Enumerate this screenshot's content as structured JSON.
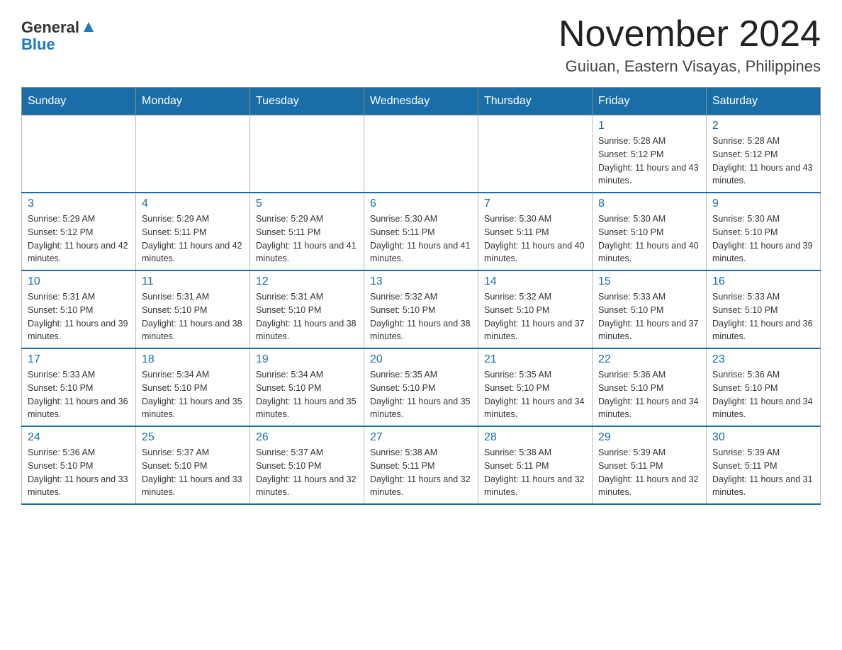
{
  "header": {
    "logo_general": "General",
    "logo_blue": "Blue",
    "main_title": "November 2024",
    "subtitle": "Guiuan, Eastern Visayas, Philippines"
  },
  "calendar": {
    "headers": [
      "Sunday",
      "Monday",
      "Tuesday",
      "Wednesday",
      "Thursday",
      "Friday",
      "Saturday"
    ],
    "weeks": [
      {
        "days": [
          {
            "number": "",
            "info": "",
            "empty": true
          },
          {
            "number": "",
            "info": "",
            "empty": true
          },
          {
            "number": "",
            "info": "",
            "empty": true
          },
          {
            "number": "",
            "info": "",
            "empty": true
          },
          {
            "number": "",
            "info": "",
            "empty": true
          },
          {
            "number": "1",
            "info": "Sunrise: 5:28 AM\nSunset: 5:12 PM\nDaylight: 11 hours and 43 minutes.",
            "empty": false
          },
          {
            "number": "2",
            "info": "Sunrise: 5:28 AM\nSunset: 5:12 PM\nDaylight: 11 hours and 43 minutes.",
            "empty": false
          }
        ]
      },
      {
        "days": [
          {
            "number": "3",
            "info": "Sunrise: 5:29 AM\nSunset: 5:12 PM\nDaylight: 11 hours and 42 minutes.",
            "empty": false
          },
          {
            "number": "4",
            "info": "Sunrise: 5:29 AM\nSunset: 5:11 PM\nDaylight: 11 hours and 42 minutes.",
            "empty": false
          },
          {
            "number": "5",
            "info": "Sunrise: 5:29 AM\nSunset: 5:11 PM\nDaylight: 11 hours and 41 minutes.",
            "empty": false
          },
          {
            "number": "6",
            "info": "Sunrise: 5:30 AM\nSunset: 5:11 PM\nDaylight: 11 hours and 41 minutes.",
            "empty": false
          },
          {
            "number": "7",
            "info": "Sunrise: 5:30 AM\nSunset: 5:11 PM\nDaylight: 11 hours and 40 minutes.",
            "empty": false
          },
          {
            "number": "8",
            "info": "Sunrise: 5:30 AM\nSunset: 5:10 PM\nDaylight: 11 hours and 40 minutes.",
            "empty": false
          },
          {
            "number": "9",
            "info": "Sunrise: 5:30 AM\nSunset: 5:10 PM\nDaylight: 11 hours and 39 minutes.",
            "empty": false
          }
        ]
      },
      {
        "days": [
          {
            "number": "10",
            "info": "Sunrise: 5:31 AM\nSunset: 5:10 PM\nDaylight: 11 hours and 39 minutes.",
            "empty": false
          },
          {
            "number": "11",
            "info": "Sunrise: 5:31 AM\nSunset: 5:10 PM\nDaylight: 11 hours and 38 minutes.",
            "empty": false
          },
          {
            "number": "12",
            "info": "Sunrise: 5:31 AM\nSunset: 5:10 PM\nDaylight: 11 hours and 38 minutes.",
            "empty": false
          },
          {
            "number": "13",
            "info": "Sunrise: 5:32 AM\nSunset: 5:10 PM\nDaylight: 11 hours and 38 minutes.",
            "empty": false
          },
          {
            "number": "14",
            "info": "Sunrise: 5:32 AM\nSunset: 5:10 PM\nDaylight: 11 hours and 37 minutes.",
            "empty": false
          },
          {
            "number": "15",
            "info": "Sunrise: 5:33 AM\nSunset: 5:10 PM\nDaylight: 11 hours and 37 minutes.",
            "empty": false
          },
          {
            "number": "16",
            "info": "Sunrise: 5:33 AM\nSunset: 5:10 PM\nDaylight: 11 hours and 36 minutes.",
            "empty": false
          }
        ]
      },
      {
        "days": [
          {
            "number": "17",
            "info": "Sunrise: 5:33 AM\nSunset: 5:10 PM\nDaylight: 11 hours and 36 minutes.",
            "empty": false
          },
          {
            "number": "18",
            "info": "Sunrise: 5:34 AM\nSunset: 5:10 PM\nDaylight: 11 hours and 35 minutes.",
            "empty": false
          },
          {
            "number": "19",
            "info": "Sunrise: 5:34 AM\nSunset: 5:10 PM\nDaylight: 11 hours and 35 minutes.",
            "empty": false
          },
          {
            "number": "20",
            "info": "Sunrise: 5:35 AM\nSunset: 5:10 PM\nDaylight: 11 hours and 35 minutes.",
            "empty": false
          },
          {
            "number": "21",
            "info": "Sunrise: 5:35 AM\nSunset: 5:10 PM\nDaylight: 11 hours and 34 minutes.",
            "empty": false
          },
          {
            "number": "22",
            "info": "Sunrise: 5:36 AM\nSunset: 5:10 PM\nDaylight: 11 hours and 34 minutes.",
            "empty": false
          },
          {
            "number": "23",
            "info": "Sunrise: 5:36 AM\nSunset: 5:10 PM\nDaylight: 11 hours and 34 minutes.",
            "empty": false
          }
        ]
      },
      {
        "days": [
          {
            "number": "24",
            "info": "Sunrise: 5:36 AM\nSunset: 5:10 PM\nDaylight: 11 hours and 33 minutes.",
            "empty": false
          },
          {
            "number": "25",
            "info": "Sunrise: 5:37 AM\nSunset: 5:10 PM\nDaylight: 11 hours and 33 minutes.",
            "empty": false
          },
          {
            "number": "26",
            "info": "Sunrise: 5:37 AM\nSunset: 5:10 PM\nDaylight: 11 hours and 32 minutes.",
            "empty": false
          },
          {
            "number": "27",
            "info": "Sunrise: 5:38 AM\nSunset: 5:11 PM\nDaylight: 11 hours and 32 minutes.",
            "empty": false
          },
          {
            "number": "28",
            "info": "Sunrise: 5:38 AM\nSunset: 5:11 PM\nDaylight: 11 hours and 32 minutes.",
            "empty": false
          },
          {
            "number": "29",
            "info": "Sunrise: 5:39 AM\nSunset: 5:11 PM\nDaylight: 11 hours and 32 minutes.",
            "empty": false
          },
          {
            "number": "30",
            "info": "Sunrise: 5:39 AM\nSunset: 5:11 PM\nDaylight: 11 hours and 31 minutes.",
            "empty": false
          }
        ]
      }
    ]
  }
}
